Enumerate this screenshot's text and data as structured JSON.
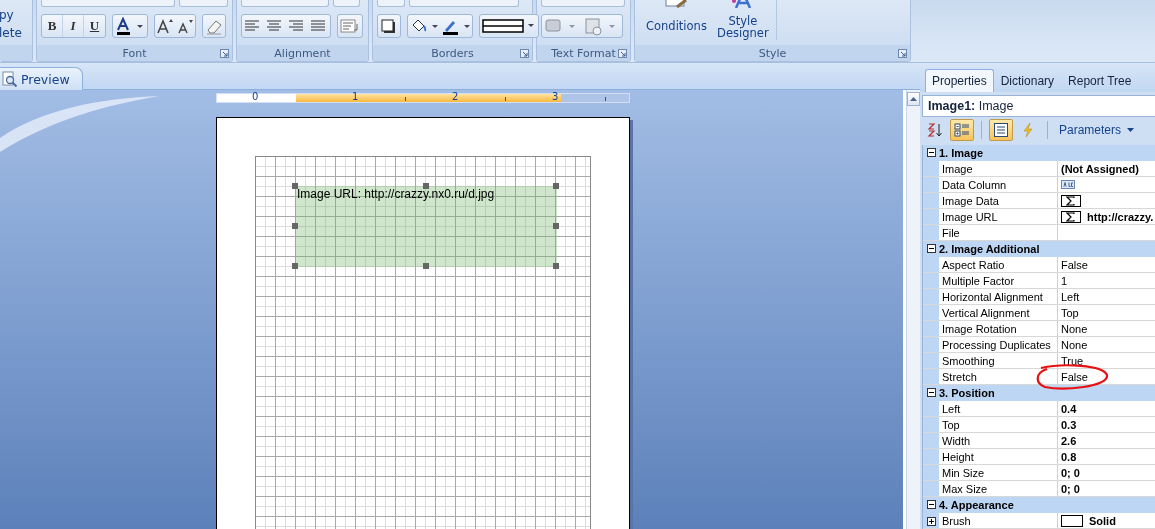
{
  "ribbon": {
    "clipped_labels": [
      "py",
      "lete"
    ],
    "groups": [
      {
        "kind": "font",
        "label": "Font",
        "launcher": true,
        "buttons": [
          "B",
          "I",
          "U"
        ]
      },
      {
        "kind": "alignment",
        "label": "Alignment",
        "launcher": false
      },
      {
        "kind": "borders",
        "label": "Borders",
        "launcher": true
      },
      {
        "kind": "text-format",
        "label": "Text Format",
        "launcher": true
      },
      {
        "kind": "style",
        "label": "Style",
        "launcher": true,
        "buttons": [
          "Conditions",
          "Style Designer"
        ]
      }
    ]
  },
  "document_tabs": [
    {
      "label": "Preview",
      "selected": false
    }
  ],
  "ruler": {
    "labels": [
      "0",
      "1",
      "2",
      "3"
    ]
  },
  "component": {
    "text": "Image URL: http://crazzy.nx0.ru/d.jpg",
    "selected": true
  },
  "properties": {
    "tabs": [
      {
        "label": "Properties",
        "selected": true
      },
      {
        "label": "Dictionary",
        "selected": false
      },
      {
        "label": "Report Tree",
        "selected": false
      }
    ],
    "title": "**Image1:** Image",
    "toolbar": {
      "sort_alphabetical": false,
      "categorized": true,
      "property_view": true,
      "events": false,
      "parameters": "Parameters"
    },
    "categories": [
      {
        "label": "1. Image",
        "expanded": true,
        "rows": [
          {
            "name": "Image",
            "kind": "bold",
            "value": "(Not Assigned)",
            "circled": false
          },
          {
            "name": "Data Column",
            "kind": "abc",
            "circled": false
          },
          {
            "name": "Image Data",
            "kind": "sigma",
            "circled": false
          },
          {
            "name": "Image URL",
            "kind": "sigma",
            "value": "http://crazzy.",
            "circled": false
          },
          {
            "name": "File",
            "kind": "text",
            "circled": false
          }
        ]
      },
      {
        "label": "2. Image Additional",
        "expanded": true,
        "rows": [
          {
            "name": "Aspect Ratio",
            "kind": "text",
            "value": "False",
            "circled": false
          },
          {
            "name": "Multiple Factor",
            "kind": "text",
            "value": "1",
            "circled": false
          },
          {
            "name": "Horizontal Alignment",
            "kind": "text",
            "value": "Left",
            "circled": false
          },
          {
            "name": "Vertical Alignment",
            "kind": "text",
            "value": "Top",
            "circled": false
          },
          {
            "name": "Image Rotation",
            "kind": "text",
            "value": "None",
            "circled": false
          },
          {
            "name": "Processing Duplicates",
            "kind": "text",
            "value": "None",
            "circled": false
          },
          {
            "name": "Smoothing",
            "kind": "text",
            "value": "True",
            "circled": false
          },
          {
            "name": "Stretch",
            "kind": "text",
            "value": "False",
            "circled": true
          }
        ]
      },
      {
        "label": "3. Position",
        "expanded": true,
        "rows": [
          {
            "name": "Left",
            "kind": "bold",
            "value": "0.4",
            "circled": false
          },
          {
            "name": "Top",
            "kind": "bold",
            "value": "0.3",
            "circled": false
          },
          {
            "name": "Width",
            "kind": "bold",
            "value": "2.6",
            "circled": false
          },
          {
            "name": "Height",
            "kind": "bold",
            "value": "0.8",
            "circled": false
          },
          {
            "name": "Min Size",
            "kind": "bold",
            "value": "0; 0",
            "circled": false
          },
          {
            "name": "Max Size",
            "kind": "bold",
            "value": "0; 0",
            "circled": false
          }
        ]
      },
      {
        "label": "4. Appearance",
        "expanded": true,
        "rows": [
          {
            "name": "Brush",
            "kind": "brush",
            "value": "Solid",
            "expanded": false,
            "circled": false
          }
        ]
      }
    ]
  }
}
